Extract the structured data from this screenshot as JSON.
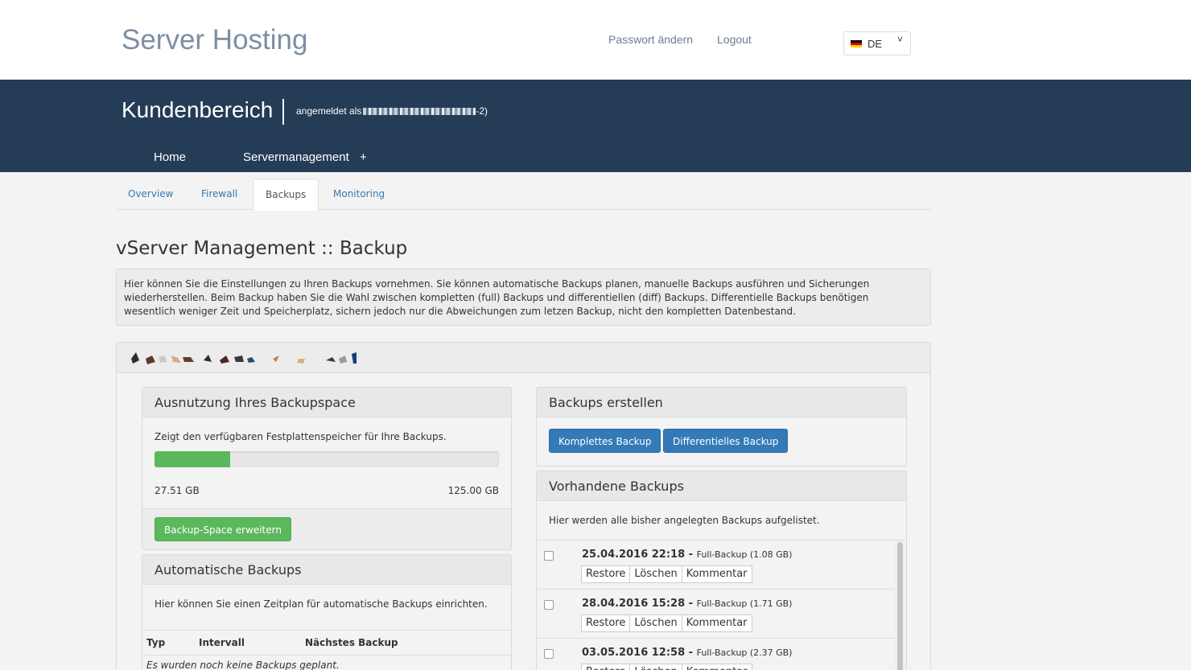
{
  "header": {
    "brand": "Server Hosting",
    "links": [
      "Passwort ändern",
      "Logout"
    ],
    "language": "DE",
    "chevron": "˅"
  },
  "band": {
    "title": "Kundenbereich",
    "login_prefix": "angemeldet als",
    "login_suffix": "-2)",
    "nav": [
      "Home",
      "Servermanagement",
      "+"
    ]
  },
  "tabs": [
    {
      "label": "Overview",
      "active": false
    },
    {
      "label": "Firewall",
      "active": false
    },
    {
      "label": "Backups",
      "active": true
    },
    {
      "label": "Monitoring",
      "active": false
    }
  ],
  "page": {
    "title": "vServer Management :: Backup",
    "intro": "Hier können Sie die Einstellungen zu Ihren Backups vornehmen. Sie können automatische Backups planen, manuelle Backups ausführen und Sicherungen wiederherstellen. Beim Backup haben Sie die Wahl zwischen kompletten (full) Backups und differentiellen (diff) Backups. Differentielle Backups benötigen wesentlich weniger Zeit und Speicherplatz, sichern jedoch nur die Abweichungen zum letzen Backup, nicht den kompletten Datenbestand."
  },
  "usage": {
    "title": "Ausnutzung Ihres Backupspace",
    "description": "Zeigt den verfügbaren Festplattenspeicher für Ihre Backups.",
    "used": "27.51 GB",
    "total": "125.00 GB",
    "fraction": 0.22,
    "button": "Backup-Space erweitern"
  },
  "auto": {
    "title": "Automatische Backups",
    "description": "Hier können Sie einen Zeitplan für automatische Backups einrichten.",
    "columns": [
      "Typ",
      "Intervall",
      "Nächstes Backup"
    ],
    "empty": "Es wurden noch keine Backups geplant."
  },
  "create": {
    "title": "Backups erstellen",
    "buttons": [
      "Komplettes Backup",
      "Differentielles Backup"
    ]
  },
  "existing": {
    "title": "Vorhandene Backups",
    "description": "Hier werden alle bisher angelegten Backups aufgelistet.",
    "separator": " - ",
    "actions": [
      "Restore",
      "Löschen",
      "Kommentar"
    ],
    "items": [
      {
        "date": "25.04.2016 22:18",
        "info": "Full-Backup (1.08 GB)"
      },
      {
        "date": "28.04.2016 15:28",
        "info": "Full-Backup (1.71 GB)"
      },
      {
        "date": "03.05.2016 12:58",
        "info": "Full-Backup (2.37 GB)"
      }
    ]
  },
  "colors": {
    "band": "#243c56",
    "link": "#337ab7",
    "success": "#5cb85c",
    "primary": "#337ab7"
  }
}
